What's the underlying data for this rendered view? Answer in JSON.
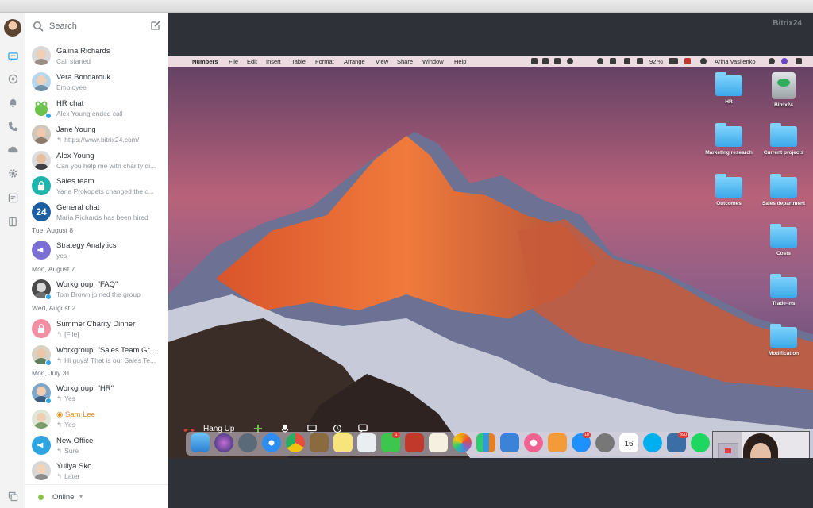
{
  "colors": {
    "accent": "#2fa6e1",
    "online": "#8bc34a",
    "hangup": "#e53935"
  },
  "rail": {
    "icons": [
      "chat-icon",
      "notifications-icon",
      "bell-icon",
      "phone-icon",
      "drive-icon",
      "settings-icon",
      "tasks-icon",
      "copy-icon"
    ]
  },
  "search": {
    "placeholder": "Search"
  },
  "chats": [
    {
      "name": "Galina Richards",
      "sub": "Call started",
      "reply": false
    },
    {
      "name": "Vera Bondarouk",
      "sub": "Employee",
      "reply": false
    },
    {
      "name": "HR chat",
      "sub": "Alex Young ended call",
      "reply": false
    },
    {
      "name": "Jane Young",
      "sub": "https://www.bitrix24.com/",
      "reply": true
    },
    {
      "name": "Alex Young",
      "sub": "Can you help me with charity di...",
      "reply": false
    },
    {
      "name": "Sales team",
      "sub": "Yana Prokopets changed the c...",
      "reply": false
    },
    {
      "name": "General chat",
      "sub": "Maria Richards has been hired",
      "reply": false
    },
    {
      "name": "Strategy Analytics",
      "sub": "yes",
      "reply": false
    },
    {
      "name": "Workgroup: \"FAQ\"",
      "sub": "Tom Brown joined the group",
      "reply": false
    },
    {
      "name": "Summer Charity Dinner",
      "sub": "[File]",
      "reply": true
    },
    {
      "name": "Workgroup: \"Sales Team Gr...",
      "sub": "Hi guys! That is our Sales Te...",
      "reply": true
    },
    {
      "name": "Workgroup: \"HR\"",
      "sub": "Yes",
      "reply": true
    },
    {
      "name": "Sam Lee",
      "sub": "Yes",
      "reply": true
    },
    {
      "name": "New Office",
      "sub": "Sure",
      "reply": true
    },
    {
      "name": "Yuliya Sko",
      "sub": "Later",
      "reply": true
    }
  ],
  "dates": [
    "Tue, August 8",
    "Mon, August 7",
    "Wed, August 2",
    "Mon, July 31"
  ],
  "status": {
    "label": "Online"
  },
  "brand": "Bitrix24",
  "mac_menu": {
    "app": "Numbers",
    "items": [
      "File",
      "Edit",
      "Insert",
      "Table",
      "Format",
      "Arrange",
      "View",
      "Share",
      "Window",
      "Help"
    ],
    "battery": "92 %",
    "user": "Arina Vasilenko"
  },
  "desktop": [
    {
      "label": "HR",
      "type": "folder"
    },
    {
      "label": "Bitrix24",
      "type": "drive"
    },
    {
      "label": "Marketing research",
      "type": "folder"
    },
    {
      "label": "Current projects",
      "type": "folder"
    },
    {
      "label": "Outcomes",
      "type": "folder"
    },
    {
      "label": "Sales department",
      "type": "folder"
    },
    {
      "label": "Costs",
      "type": "folder"
    },
    {
      "label": "Trade-ins",
      "type": "folder"
    },
    {
      "label": "Modification",
      "type": "folder"
    }
  ],
  "call": {
    "hangup_label": "Hang Up"
  },
  "dock_badges": {
    "messages": "1",
    "appstore": "10",
    "photos": "390"
  },
  "calendar_day": "16"
}
